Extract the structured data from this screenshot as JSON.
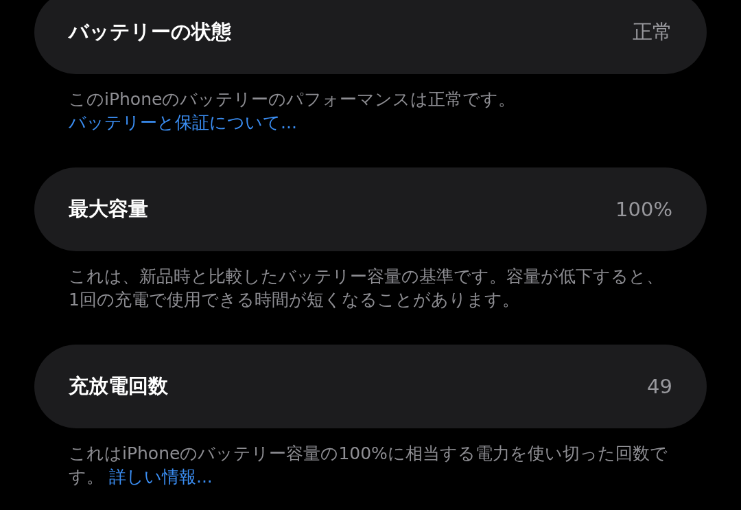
{
  "sections": [
    {
      "label": "バッテリーの状態",
      "value": "正常",
      "note": {
        "text": "このiPhoneのバッテリーのパフォーマンスは正常です。",
        "link": "バッテリーと保証について..."
      }
    },
    {
      "label": "最大容量",
      "value": "100%",
      "note": {
        "text": "これは、新品時と比較したバッテリー容量の基準です。容量が低下すると、1回の充電で使用できる時間が短くなることがあります。"
      }
    },
    {
      "label": "充放電回数",
      "value": "49",
      "note": {
        "text": "これはiPhoneのバッテリー容量の100%に相当する電力を使い切った回数です。",
        "link": "詳しい情報..."
      }
    }
  ]
}
